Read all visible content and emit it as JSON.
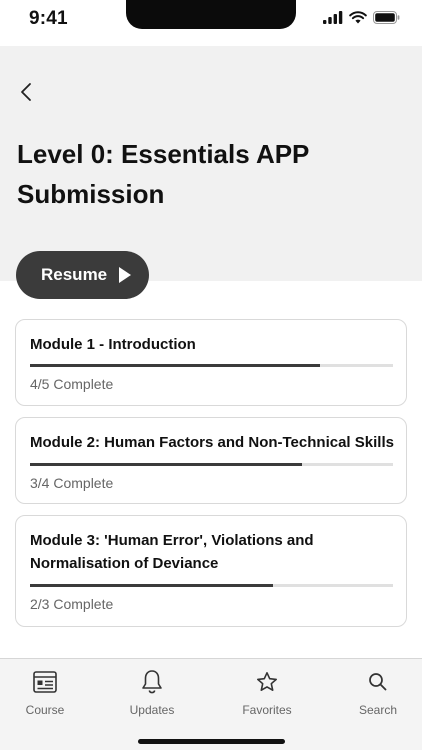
{
  "status_bar": {
    "time": "9:41"
  },
  "header": {
    "title": "Level 0: Essentials APP Submission"
  },
  "resume": {
    "label": "Resume"
  },
  "modules": [
    {
      "title": "Module 1 - Introduction",
      "progress_text": "4/5 Complete",
      "progress": 0.8
    },
    {
      "title": "Module 2: Human Factors and Non-Technical Skills",
      "progress_text": "3/4 Complete",
      "progress": 0.75
    },
    {
      "title": "Module 3: 'Human Error', Violations and Normalisation of Deviance",
      "progress_text": "2/3 Complete",
      "progress": 0.67
    }
  ],
  "tabs": [
    {
      "label": "Course",
      "icon": "course-icon"
    },
    {
      "label": "Updates",
      "icon": "bell-icon"
    },
    {
      "label": "Favorites",
      "icon": "star-icon"
    },
    {
      "label": "Search",
      "icon": "search-icon"
    }
  ],
  "colors": {
    "accent": "#3b3b3b",
    "header_bg": "#f1f1f1",
    "tabbar_bg": "#f4f4f4"
  }
}
